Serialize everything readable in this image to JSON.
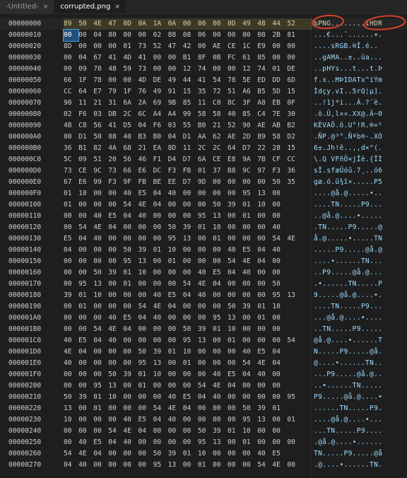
{
  "tabs": [
    {
      "label": "-Untitled-",
      "active": false,
      "close": "×"
    },
    {
      "label": "corrupted.png",
      "active": true,
      "close": "×"
    }
  ],
  "rows": [
    {
      "offset": "00000000",
      "bytes": [
        "89",
        "50",
        "4E",
        "47",
        "0D",
        "0A",
        "1A",
        "0A",
        "00",
        "00",
        "00",
        "0D",
        "49",
        "48",
        "44",
        "52"
      ],
      "ascii": "‰PNG........IHDR"
    },
    {
      "offset": "00000010",
      "bytes": [
        "00",
        "00",
        "04",
        "80",
        "00",
        "00",
        "02",
        "88",
        "08",
        "06",
        "00",
        "00",
        "00",
        "08",
        "2B",
        "81"
      ],
      "ascii": "...€...ˆ......+."
    },
    {
      "offset": "00000020",
      "bytes": [
        "8D",
        "00",
        "00",
        "00",
        "01",
        "73",
        "52",
        "47",
        "42",
        "00",
        "AE",
        "CE",
        "1C",
        "E9",
        "00",
        "00"
      ],
      "ascii": "....sRGB.®Î.é.."
    },
    {
      "offset": "00000030",
      "bytes": [
        "00",
        "04",
        "67",
        "41",
        "4D",
        "41",
        "00",
        "00",
        "B1",
        "8F",
        "0B",
        "FC",
        "61",
        "05",
        "00",
        "00"
      ],
      "ascii": "..gAMA..±..üa..."
    },
    {
      "offset": "00000040",
      "bytes": [
        "00",
        "09",
        "70",
        "48",
        "59",
        "73",
        "00",
        "00",
        "12",
        "74",
        "00",
        "00",
        "12",
        "74",
        "01",
        "DE"
      ],
      "ascii": "..pHYs...t...t.Þ"
    },
    {
      "offset": "00000050",
      "bytes": [
        "66",
        "1F",
        "78",
        "00",
        "00",
        "4D",
        "DE",
        "49",
        "44",
        "41",
        "54",
        "78",
        "5E",
        "ED",
        "DD",
        "6D"
      ],
      "ascii": "f.x..MÞIDATx^íÝm"
    },
    {
      "offset": "00000060",
      "bytes": [
        "CC",
        "64",
        "E7",
        "79",
        "1F",
        "76",
        "49",
        "91",
        "15",
        "35",
        "72",
        "51",
        "A6",
        "B5",
        "5D",
        "15"
      ],
      "ascii": "Ìdçy.vI..5rQ¦µ]."
    },
    {
      "offset": "00000070",
      "bytes": [
        "90",
        "11",
        "21",
        "31",
        "6A",
        "2A",
        "69",
        "9B",
        "85",
        "11",
        "C0",
        "8C",
        "3F",
        "A8",
        "EB",
        "0F"
      ],
      "ascii": "..!1j*i...À.?¨ë."
    },
    {
      "offset": "00000080",
      "bytes": [
        "02",
        "F6",
        "03",
        "DB",
        "2C",
        "6C",
        "A4",
        "A4",
        "99",
        "58",
        "58",
        "40",
        "85",
        "C4",
        "7E",
        "30"
      ],
      "ascii": ".ö.Û,l¤¤.XX@.Ä~0"
    },
    {
      "offset": "00000090",
      "bytes": [
        "4B",
        "C8",
        "56",
        "41",
        "D5",
        "04",
        "F6",
        "03",
        "55",
        "B0",
        "21",
        "52",
        "90",
        "AE",
        "AB",
        "B2"
      ],
      "ascii": "KÈVAÕ.ö.U°!R.®«²"
    },
    {
      "offset": "000000A0",
      "bytes": [
        "00",
        "D1",
        "50",
        "08",
        "40",
        "B3",
        "B0",
        "04",
        "D1",
        "AA",
        "62",
        "AE",
        "2D",
        "89",
        "58",
        "D2"
      ],
      "ascii": ".ÑP.@³°.Ñªb®-.XÒ"
    },
    {
      "offset": "000000B0",
      "bytes": [
        "36",
        "B1",
        "82",
        "4A",
        "68",
        "21",
        "EA",
        "8D",
        "11",
        "2C",
        "2C",
        "64",
        "D7",
        "22",
        "28",
        "15"
      ],
      "ascii": "6±.Jh!ê..,,d×\"(."
    },
    {
      "offset": "000000C0",
      "bytes": [
        "5C",
        "09",
        "51",
        "20",
        "56",
        "46",
        "F1",
        "D4",
        "D7",
        "6A",
        "CE",
        "E8",
        "9A",
        "7B",
        "CF",
        "CC"
      ],
      "ascii": "\\.Q VFñÔ×jÎè.{ÏÌ"
    },
    {
      "offset": "000000D0",
      "bytes": [
        "73",
        "CE",
        "9C",
        "73",
        "66",
        "E6",
        "DC",
        "F3",
        "FB",
        "01",
        "37",
        "B8",
        "9C",
        "97",
        "F3",
        "36"
      ],
      "ascii": "sÎ.sfæÜóû.7¸..ó6"
    },
    {
      "offset": "000000E0",
      "bytes": [
        "67",
        "E6",
        "99",
        "F3",
        "9F",
        "FB",
        "BE",
        "EE",
        "D7",
        "9D",
        "00",
        "00",
        "00",
        "00",
        "50",
        "35"
      ],
      "ascii": "gæ.ó.û¾î×.....P5"
    },
    {
      "offset": "000000F0",
      "bytes": [
        "01",
        "10",
        "00",
        "00",
        "40",
        "E5",
        "04",
        "40",
        "00",
        "00",
        "00",
        "00",
        "95",
        "13",
        "00"
      ],
      "ascii": "....@å.@.....•.."
    },
    {
      "offset": "00000100",
      "bytes": [
        "01",
        "00",
        "00",
        "00",
        "54",
        "4E",
        "04",
        "00",
        "00",
        "00",
        "50",
        "39",
        "01",
        "10",
        "00"
      ],
      "ascii": "....TN.....P9..."
    },
    {
      "offset": "00000110",
      "bytes": [
        "00",
        "00",
        "40",
        "E5",
        "04",
        "40",
        "00",
        "00",
        "00",
        "95",
        "13",
        "00",
        "01",
        "00",
        "00"
      ],
      "ascii": "..@å.@....•....."
    },
    {
      "offset": "00000120",
      "bytes": [
        "00",
        "54",
        "4E",
        "04",
        "00",
        "00",
        "00",
        "50",
        "39",
        "01",
        "10",
        "00",
        "00",
        "00",
        "40"
      ],
      "ascii": ".TN.....P9.....@"
    },
    {
      "offset": "00000130",
      "bytes": [
        "E5",
        "04",
        "40",
        "00",
        "00",
        "00",
        "00",
        "95",
        "13",
        "00",
        "01",
        "00",
        "00",
        "00",
        "54",
        "4E"
      ],
      "ascii": "å.@.....•.....TN"
    },
    {
      "offset": "00000140",
      "bytes": [
        "04",
        "00",
        "00",
        "00",
        "50",
        "39",
        "01",
        "10",
        "00",
        "00",
        "00",
        "40",
        "E5",
        "04",
        "40"
      ],
      "ascii": ".....P9.....@å.@"
    },
    {
      "offset": "00000150",
      "bytes": [
        "00",
        "00",
        "00",
        "00",
        "95",
        "13",
        "00",
        "01",
        "00",
        "00",
        "00",
        "54",
        "4E",
        "04",
        "00"
      ],
      "ascii": "....•......TN..."
    },
    {
      "offset": "00000160",
      "bytes": [
        "00",
        "00",
        "50",
        "39",
        "01",
        "10",
        "00",
        "00",
        "00",
        "40",
        "E5",
        "04",
        "40",
        "00",
        "00"
      ],
      "ascii": "..P9.....@å.@..."
    },
    {
      "offset": "00000170",
      "bytes": [
        "00",
        "95",
        "13",
        "00",
        "01",
        "00",
        "00",
        "00",
        "54",
        "4E",
        "04",
        "00",
        "00",
        "00",
        "50"
      ],
      "ascii": ".•......TN.....P"
    },
    {
      "offset": "00000180",
      "bytes": [
        "39",
        "01",
        "10",
        "00",
        "00",
        "00",
        "40",
        "E5",
        "04",
        "40",
        "00",
        "00",
        "00",
        "00",
        "95",
        "13"
      ],
      "ascii": "9.....@å.@....•."
    },
    {
      "offset": "00000190",
      "bytes": [
        "00",
        "01",
        "00",
        "00",
        "00",
        "54",
        "4E",
        "04",
        "00",
        "00",
        "00",
        "50",
        "39",
        "01",
        "10"
      ],
      "ascii": "....TN.....P9..."
    },
    {
      "offset": "000001A0",
      "bytes": [
        "00",
        "00",
        "00",
        "40",
        "E5",
        "04",
        "40",
        "00",
        "00",
        "00",
        "95",
        "13",
        "00",
        "01",
        "00"
      ],
      "ascii": "...@å.@....•...."
    },
    {
      "offset": "000001B0",
      "bytes": [
        "00",
        "00",
        "54",
        "4E",
        "04",
        "00",
        "00",
        "00",
        "50",
        "39",
        "01",
        "10",
        "00",
        "00",
        "00"
      ],
      "ascii": "..TN.....P9....."
    },
    {
      "offset": "000001C0",
      "bytes": [
        "40",
        "E5",
        "04",
        "40",
        "00",
        "00",
        "00",
        "00",
        "95",
        "13",
        "00",
        "01",
        "00",
        "00",
        "00",
        "54"
      ],
      "ascii": "@å.@....•......T"
    },
    {
      "offset": "000001D0",
      "bytes": [
        "4E",
        "04",
        "00",
        "00",
        "00",
        "50",
        "39",
        "01",
        "10",
        "00",
        "00",
        "00",
        "40",
        "E5",
        "04"
      ],
      "ascii": "N.....P9.....@å."
    },
    {
      "offset": "000001E0",
      "bytes": [
        "40",
        "00",
        "00",
        "00",
        "00",
        "95",
        "13",
        "00",
        "01",
        "00",
        "00",
        "00",
        "54",
        "4E",
        "04"
      ],
      "ascii": "@....•......TN.."
    },
    {
      "offset": "000001F0",
      "bytes": [
        "00",
        "00",
        "00",
        "50",
        "39",
        "01",
        "10",
        "00",
        "00",
        "00",
        "40",
        "E5",
        "04",
        "40",
        "00"
      ],
      "ascii": "...P9.....@å.@.."
    },
    {
      "offset": "00000200",
      "bytes": [
        "00",
        "00",
        "95",
        "13",
        "00",
        "01",
        "00",
        "00",
        "00",
        "54",
        "4E",
        "04",
        "00",
        "00",
        "00"
      ],
      "ascii": "..•......TN....."
    },
    {
      "offset": "00000210",
      "bytes": [
        "50",
        "39",
        "01",
        "10",
        "00",
        "00",
        "00",
        "40",
        "E5",
        "04",
        "40",
        "00",
        "00",
        "00",
        "00",
        "95"
      ],
      "ascii": "P9.....@å.@....•"
    },
    {
      "offset": "00000220",
      "bytes": [
        "13",
        "00",
        "01",
        "00",
        "00",
        "00",
        "54",
        "4E",
        "04",
        "00",
        "00",
        "00",
        "50",
        "39",
        "01"
      ],
      "ascii": "......TN.....P9."
    },
    {
      "offset": "00000230",
      "bytes": [
        "10",
        "00",
        "00",
        "00",
        "40",
        "E5",
        "04",
        "40",
        "00",
        "00",
        "00",
        "00",
        "95",
        "13",
        "00",
        "01"
      ],
      "ascii": "....@å.@....•..."
    },
    {
      "offset": "00000240",
      "bytes": [
        "00",
        "00",
        "00",
        "54",
        "4E",
        "04",
        "00",
        "00",
        "00",
        "50",
        "39",
        "01",
        "10",
        "00",
        "00"
      ],
      "ascii": "...TN.....P9...."
    },
    {
      "offset": "00000250",
      "bytes": [
        "00",
        "40",
        "E5",
        "04",
        "40",
        "00",
        "00",
        "00",
        "00",
        "95",
        "13",
        "00",
        "01",
        "00",
        "00",
        "00"
      ],
      "ascii": ".@å.@....•......"
    },
    {
      "offset": "00000260",
      "bytes": [
        "54",
        "4E",
        "04",
        "00",
        "00",
        "00",
        "50",
        "39",
        "01",
        "10",
        "00",
        "00",
        "00",
        "40",
        "E5"
      ],
      "ascii": "TN.....P9.....@å"
    },
    {
      "offset": "00000270",
      "bytes": [
        "04",
        "40",
        "00",
        "00",
        "00",
        "00",
        "95",
        "13",
        "00",
        "01",
        "00",
        "00",
        "00",
        "54",
        "4E",
        "00"
      ],
      "ascii": ".@....•......TN."
    }
  ],
  "colors": {
    "annotation": "#d9402b",
    "cursor": "#4aa3d8"
  }
}
